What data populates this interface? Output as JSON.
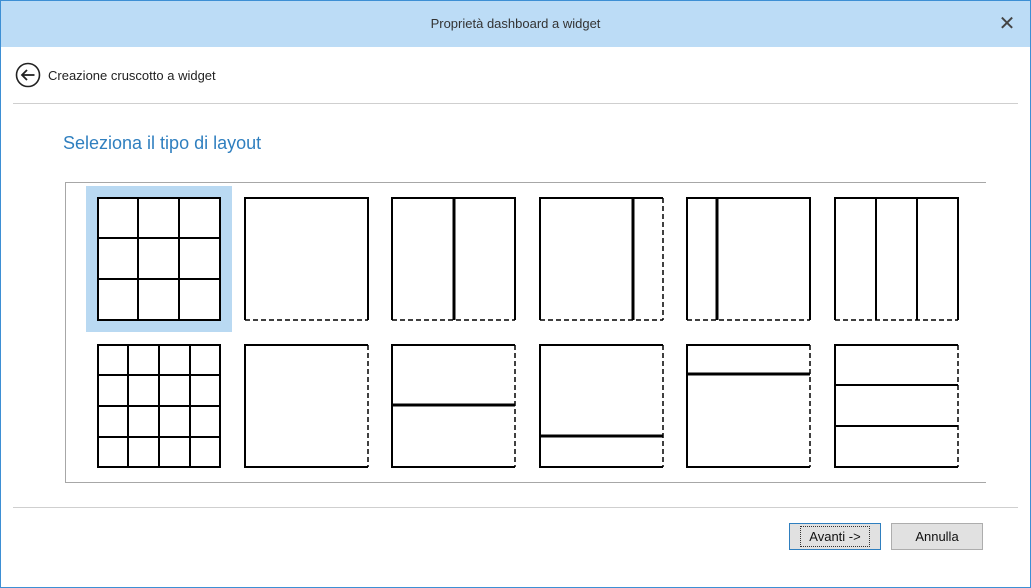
{
  "window": {
    "title": "Proprietà dashboard a widget"
  },
  "header": {
    "subtitle": "Creazione cruscotto a widget"
  },
  "section": {
    "title": "Seleziona il tipo di layout"
  },
  "layouts": [
    {
      "id": "grid-3x3",
      "selected": true
    },
    {
      "id": "single",
      "selected": false
    },
    {
      "id": "two-columns",
      "selected": false
    },
    {
      "id": "wide-narrow-columns",
      "selected": false
    },
    {
      "id": "narrow-wide-columns",
      "selected": false
    },
    {
      "id": "three-columns",
      "selected": false
    },
    {
      "id": "grid-4x4",
      "selected": false
    },
    {
      "id": "single-dashed-right",
      "selected": false
    },
    {
      "id": "two-rows",
      "selected": false
    },
    {
      "id": "tall-short-rows",
      "selected": false
    },
    {
      "id": "short-tall-rows",
      "selected": false
    },
    {
      "id": "three-rows",
      "selected": false
    }
  ],
  "buttons": {
    "next": "Avanti ->",
    "cancel": "Annulla"
  },
  "colors": {
    "accent": "#2f7fbf",
    "titlebar": "#bcdcf6",
    "selection": "#b9d9f2"
  },
  "icons": {
    "close": "close-icon",
    "back": "arrow-left-circle-icon"
  }
}
